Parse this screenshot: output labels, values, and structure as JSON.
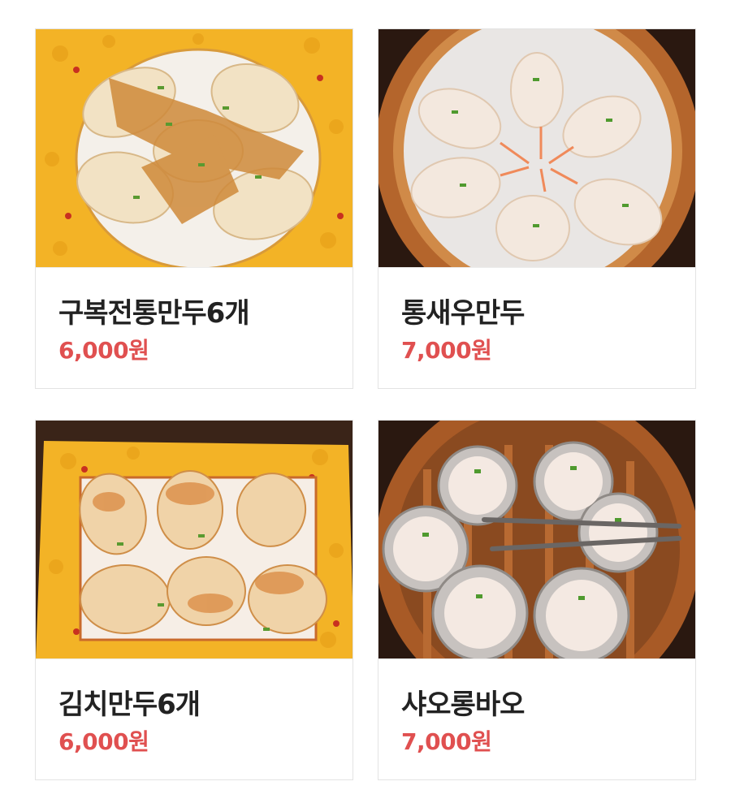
{
  "menu_items": [
    {
      "name": "구복전통만두6개",
      "price": "6,000원",
      "image": "pan-fried-dumplings-photo"
    },
    {
      "name": "통새우만두",
      "price": "7,000원",
      "image": "shrimp-dumplings-steamer-photo"
    },
    {
      "name": "김치만두6개",
      "price": "6,000원",
      "image": "kimchi-dumplings-photo"
    },
    {
      "name": "샤오롱바오",
      "price": "7,000원",
      "image": "xiaolongbao-steamer-photo"
    }
  ],
  "colors": {
    "price": "#e05050",
    "name": "#222222",
    "card_border": "#e3e3e3",
    "plate_yellow": "#f5b62a",
    "steamer_wood": "#b4652c"
  }
}
